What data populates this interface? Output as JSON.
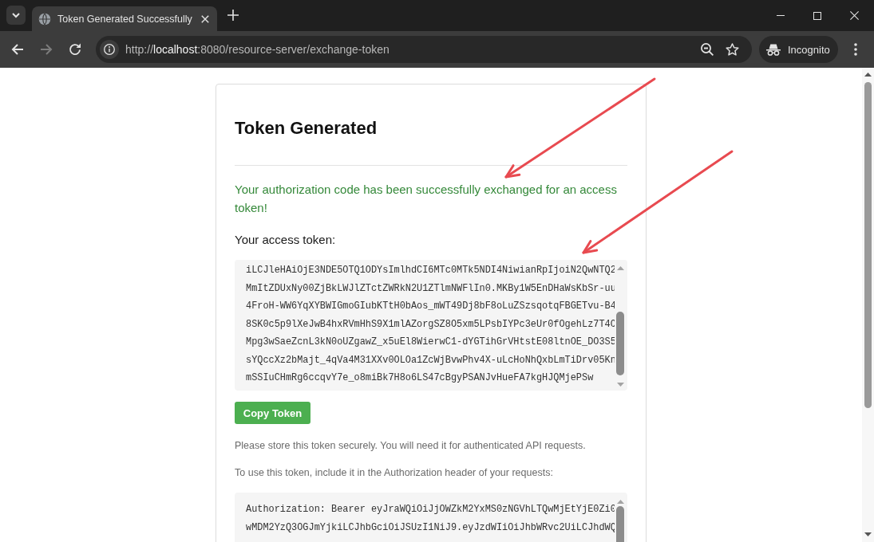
{
  "browser": {
    "tabs": [
      {
        "title": "Token Generated Successfully",
        "selected": true
      }
    ],
    "nav_buttons": [
      {
        "kind": "back",
        "disabled": false
      },
      {
        "kind": "forward",
        "disabled": true
      },
      {
        "kind": "reload",
        "disabled": false
      }
    ],
    "address_bar": {
      "url": "http://**localhost**:8080/resource-server/exchange-token"
    },
    "profile": {
      "label": "Incognito"
    }
  },
  "page": {
    "title": "Token Generated",
    "message": "Your authorization code has been successfully exchanged for an access token!",
    "token_label": "Your access token:",
    "token_lines": [
      "iLCJleHAiOjE3NDE5OTQ1ODYsImlhdCI6MTc0MTk5NDI4NiwianRpIjoiN2QwNTQ2",
      "MmItZDUxNy00ZjBkLWJlZTctZWRkN2U1ZTlmNWFlIn0.MKBy1W5EnDHaWsKbSr-uu",
      "4FroH-WW6YqXYBWIGmoGIubKTtH0bAos_mWT49Dj8bF8oLuZSzsqotqFBGETvu-B4",
      "8SK0c5p9lXeJwB4hxRVmHhS9X1mlAZorgSZ8O5xm5LPsbIYPc3eUr0fOgehLz7T4O",
      "Mpg3wSaeZcnL3kN0oUZgawZ_x5uEl8WierwC1-dYGTihGrVHtstE08ltnOE_DO3S5",
      "sYQccXz2bMajt_4qVa4M31XXv0OLOa1ZcWjBvwPhv4X-uLcHoNhQxbLmTiDrv05Kn",
      "mSSIuCHmRg6ccqvY7e_o8miBk7H8o6LS47cBgyPSANJvHueFA7kgHJQMjePSw"
    ],
    "copy_button": "Copy Token",
    "notes": [
      "Please store this token securely. You will need it for authenticated API requests.",
      "To use this token, include it in the Authorization header of your requests:"
    ],
    "header_lines": [
      "Authorization: Bearer eyJraWQiOiJjOWZkM2YxMS0zNGVhLTQwMjEtYjE0Zi0",
      "wMDM2YzQ3OGJmYjkiLCJhbGciOiJSUzI1NiJ9.eyJzdWIiOiJhbWRvc2UiLCJhdWQ"
    ]
  }
}
